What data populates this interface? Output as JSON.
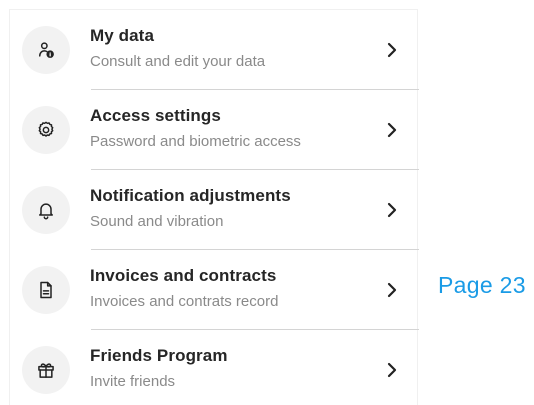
{
  "menu": {
    "items": [
      {
        "title": "My data",
        "subtitle": "Consult and edit your data",
        "icon": "user-info-icon"
      },
      {
        "title": "Access settings",
        "subtitle": "Password and biometric access",
        "icon": "gear-icon"
      },
      {
        "title": "Notification adjustments",
        "subtitle": "Sound and vibration",
        "icon": "bell-icon"
      },
      {
        "title": "Invoices and contracts",
        "subtitle": "Invoices and contrats record",
        "icon": "document-icon"
      },
      {
        "title": "Friends Program",
        "subtitle": "Invite friends",
        "icon": "gift-icon"
      }
    ]
  },
  "page_label": "Page 23",
  "colors": {
    "accent": "#1a9be6",
    "title": "#262626",
    "subtitle": "#8a8a8a",
    "icon_bg": "#f2f2f2",
    "divider": "#d4d4d4"
  }
}
